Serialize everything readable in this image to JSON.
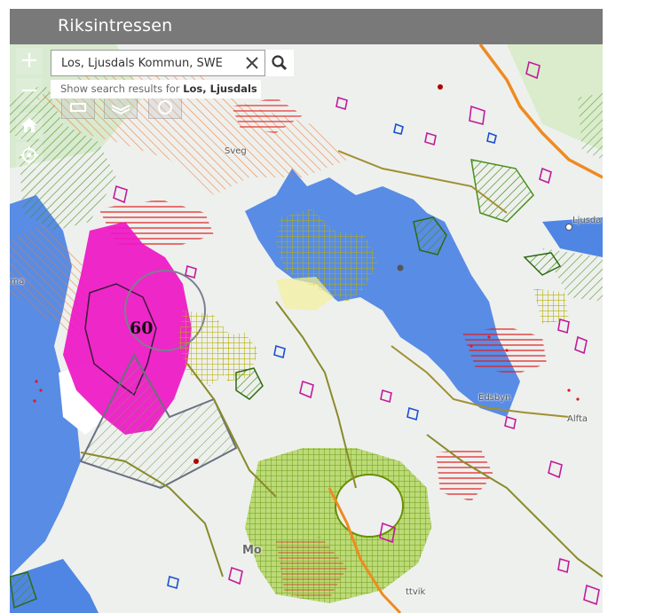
{
  "app": {
    "title": "Riksintressen"
  },
  "search": {
    "value": "Los, Ljusdals Kommun, SWE",
    "suggestion_prefix": "Show search results for",
    "suggestion_term": "Los, Ljusdals ..."
  },
  "controls": {
    "zoom_in": "+",
    "zoom_out": "−",
    "icons": [
      "home-icon",
      "locate-icon",
      "search-icon",
      "close-icon",
      "legend-icon",
      "layers-icon",
      "info-icon"
    ]
  },
  "map": {
    "labels": {
      "sveg": "Sveg",
      "ljusdal": "Ljusda",
      "edsbyn": "Edsbyn",
      "alfta": "Alfta",
      "mora": "Mo",
      "rattvik": "ttvik",
      "orsa": "rna",
      "site_number": "60"
    }
  },
  "colors": {
    "header": "#797979",
    "water_blue": "#4f86e4",
    "magenta": "#ee16c4",
    "green_hatch": "#7fb600",
    "red_hatch": "#e01a1a",
    "orange_hatch": "#f07a2e"
  }
}
